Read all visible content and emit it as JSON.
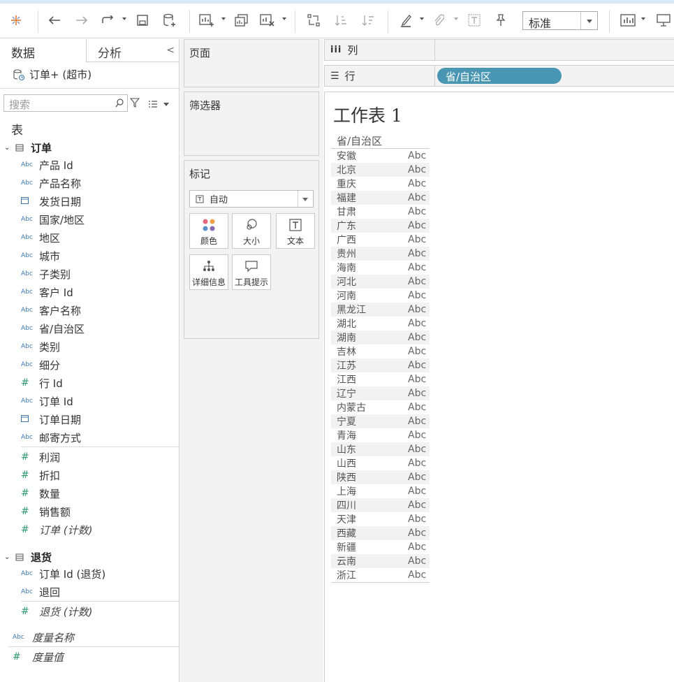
{
  "toolbar": {
    "view_select": "标准"
  },
  "left_pane": {
    "tab_data": "数据",
    "tab_analysis": "分析",
    "datasource": "订单+ (超市)",
    "search_placeholder": "搜索",
    "section_title": "表",
    "group_orders": "订单",
    "group_returns": "退货",
    "orders_dimensions": [
      {
        "icon": "Abc",
        "type": "string",
        "name": "产品 Id"
      },
      {
        "icon": "Abc",
        "type": "string",
        "name": "产品名称"
      },
      {
        "icon": "date",
        "type": "date",
        "name": "发货日期"
      },
      {
        "icon": "Abc",
        "type": "string",
        "name": "国家/地区"
      },
      {
        "icon": "Abc",
        "type": "string",
        "name": "地区"
      },
      {
        "icon": "Abc",
        "type": "string",
        "name": "城市"
      },
      {
        "icon": "Abc",
        "type": "string",
        "name": "子类别"
      },
      {
        "icon": "Abc",
        "type": "string",
        "name": "客户 Id"
      },
      {
        "icon": "Abc",
        "type": "string",
        "name": "客户名称"
      },
      {
        "icon": "Abc",
        "type": "string",
        "name": "省/自治区"
      },
      {
        "icon": "Abc",
        "type": "string",
        "name": "类别"
      },
      {
        "icon": "Abc",
        "type": "string",
        "name": "细分"
      },
      {
        "icon": "#",
        "type": "number",
        "name": "行 Id"
      },
      {
        "icon": "Abc",
        "type": "string",
        "name": "订单 Id"
      },
      {
        "icon": "date",
        "type": "date",
        "name": "订单日期"
      },
      {
        "icon": "Abc",
        "type": "string",
        "name": "邮寄方式"
      }
    ],
    "orders_measures": [
      {
        "icon": "#",
        "name": "利润",
        "italic": false
      },
      {
        "icon": "#",
        "name": "折扣",
        "italic": false
      },
      {
        "icon": "#",
        "name": "数量",
        "italic": false
      },
      {
        "icon": "#",
        "name": "销售额",
        "italic": false
      },
      {
        "icon": "#",
        "name": "订单 (计数)",
        "italic": true
      }
    ],
    "returns_dimensions": [
      {
        "icon": "Abc",
        "name": "订单 Id (退货)"
      },
      {
        "icon": "Abc",
        "name": "退回"
      }
    ],
    "returns_measures": [
      {
        "icon": "#",
        "name": "退货 (计数)",
        "italic": true
      }
    ],
    "measure_names": "度量名称",
    "measure_values": "度量值"
  },
  "middle": {
    "pages": "页面",
    "filters": "筛选器",
    "marks": "标记",
    "mark_type": "自动",
    "mark_buttons": [
      "颜色",
      "大小",
      "文本",
      "详细信息",
      "工具提示"
    ]
  },
  "shelves": {
    "columns_label": "列",
    "rows_label": "行",
    "rows_pill": "省/自治区"
  },
  "sheet": {
    "title": "工作表 1",
    "column_header": "省/自治区",
    "cell_placeholder": "Abc",
    "provinces": [
      "安徽",
      "北京",
      "重庆",
      "福建",
      "甘肃",
      "广东",
      "广西",
      "贵州",
      "海南",
      "河北",
      "河南",
      "黑龙江",
      "湖北",
      "湖南",
      "吉林",
      "江苏",
      "江西",
      "辽宁",
      "内蒙古",
      "宁夏",
      "青海",
      "山东",
      "山西",
      "陕西",
      "上海",
      "四川",
      "天津",
      "西藏",
      "新疆",
      "云南",
      "浙江"
    ]
  }
}
